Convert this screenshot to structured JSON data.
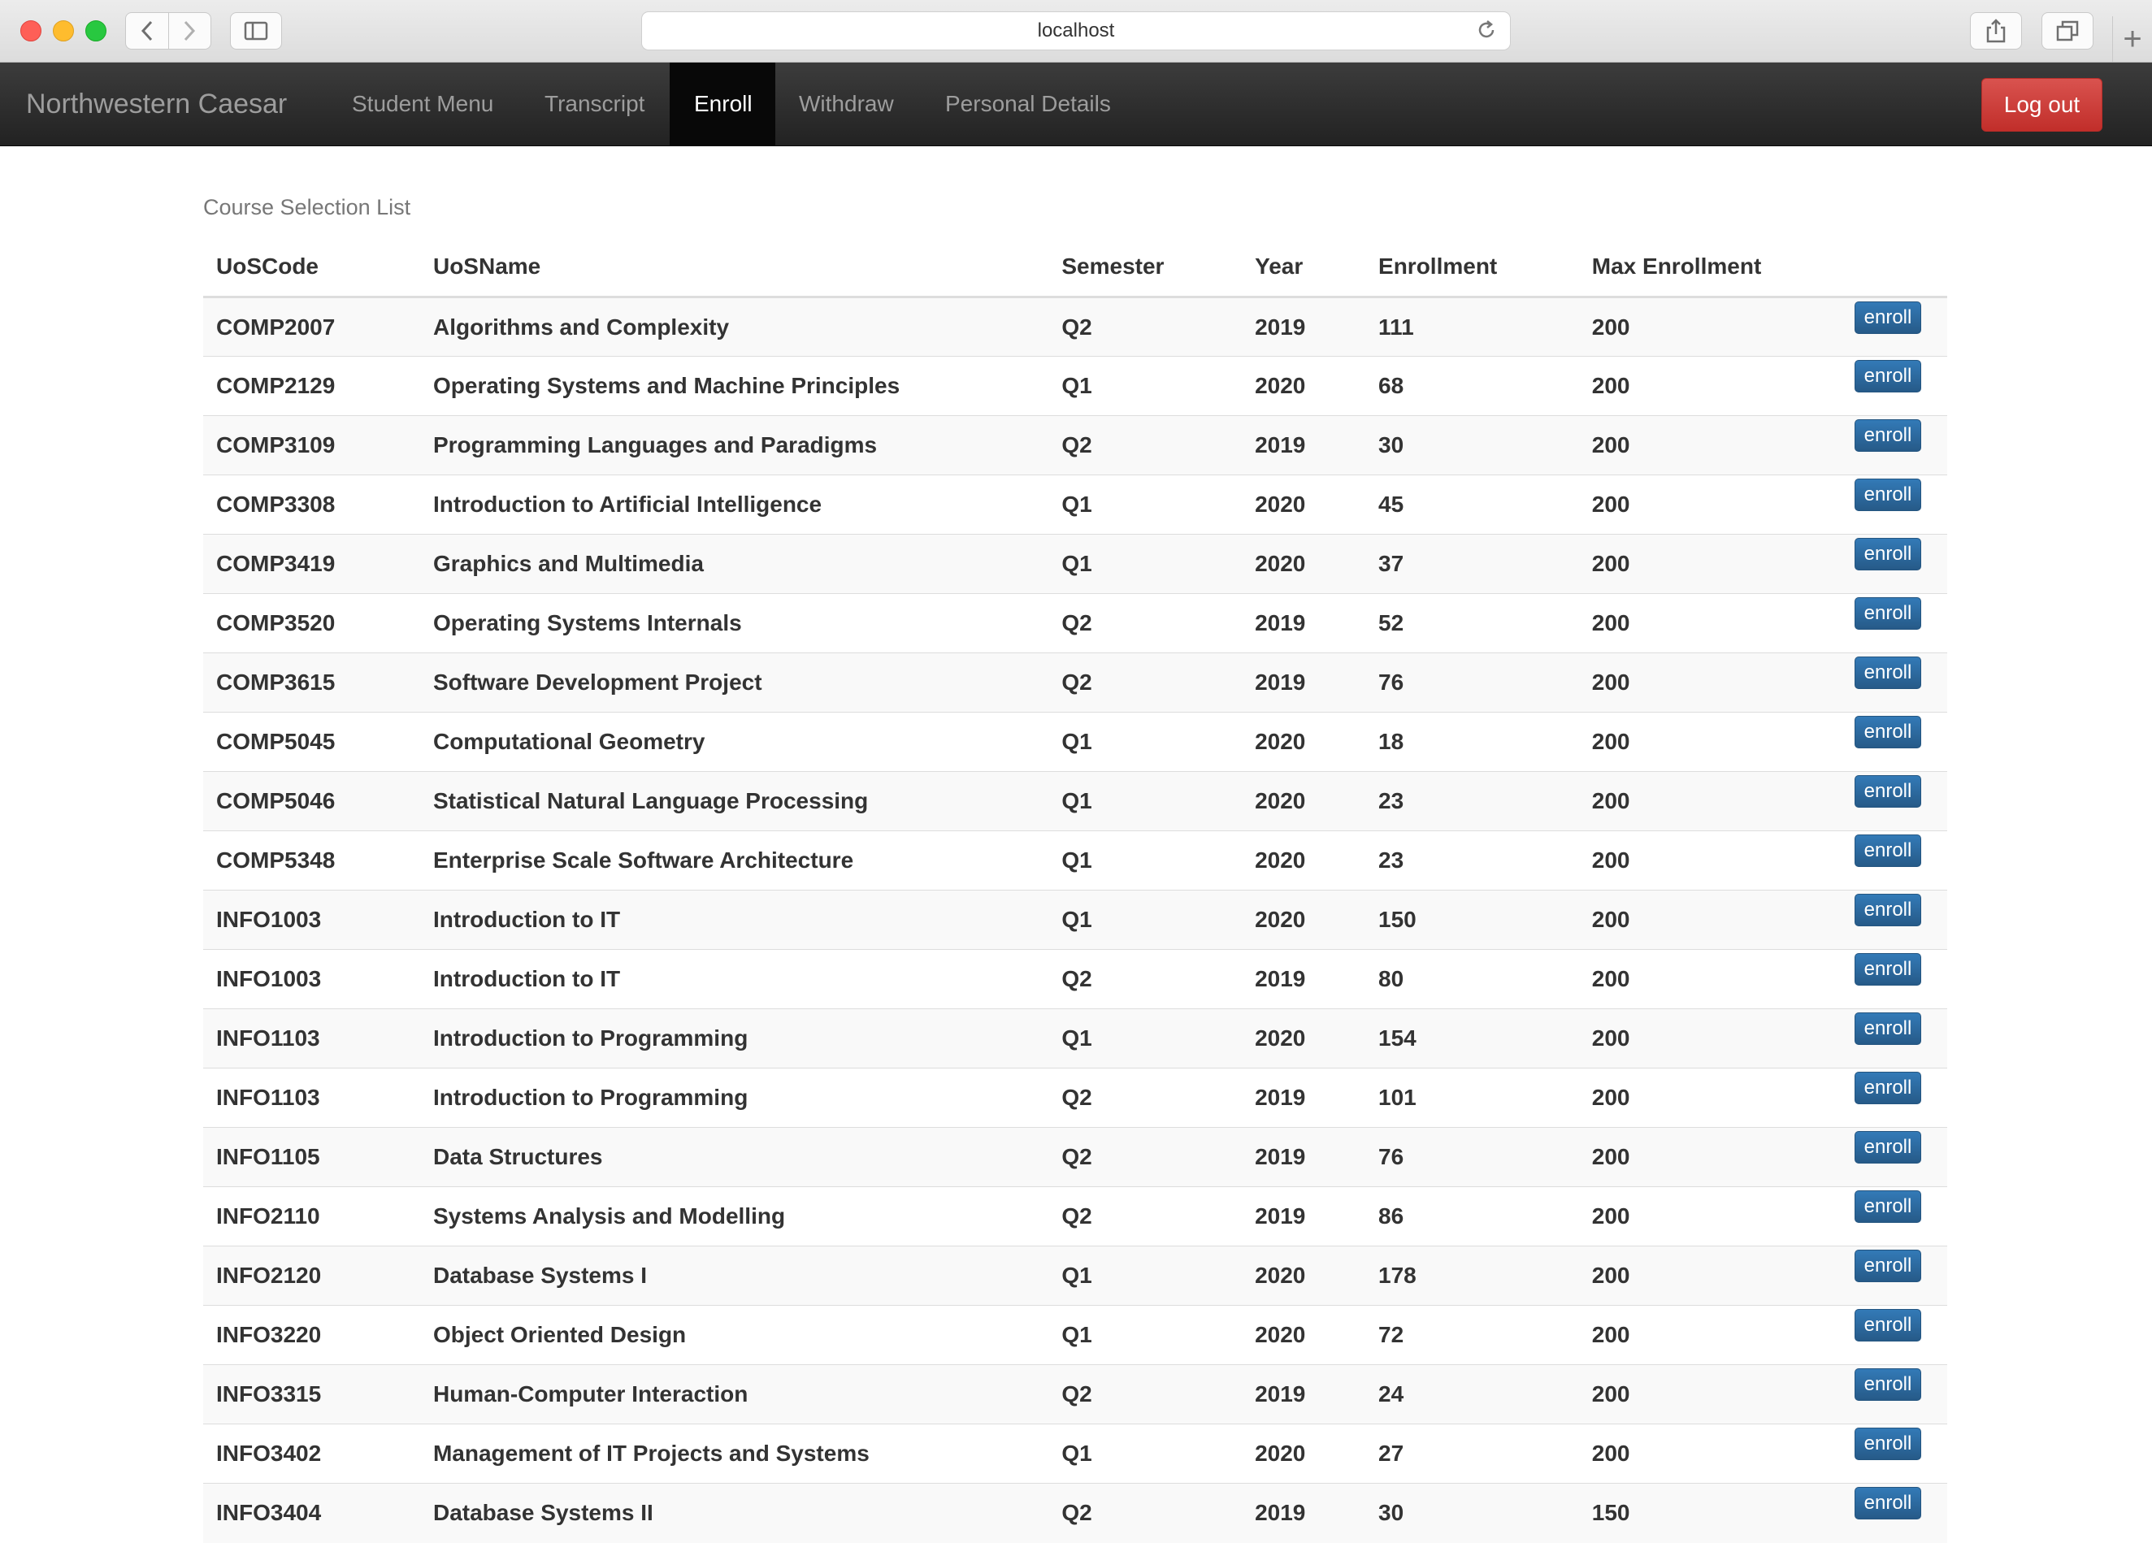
{
  "browser": {
    "url": "localhost"
  },
  "navbar": {
    "brand": "Northwestern Caesar",
    "items": [
      {
        "label": "Student Menu"
      },
      {
        "label": "Transcript"
      },
      {
        "label": "Enroll"
      },
      {
        "label": "Withdraw"
      },
      {
        "label": "Personal Details"
      }
    ],
    "active_item": "Enroll",
    "logout_label": "Log out"
  },
  "main": {
    "caption": "Course Selection List",
    "columns": [
      "UoSCode",
      "UoSName",
      "Semester",
      "Year",
      "Enrollment",
      "Max Enrollment"
    ],
    "action_label": "enroll",
    "rows": [
      {
        "code": "COMP2007",
        "name": "Algorithms and Complexity",
        "semester": "Q2",
        "year": "2019",
        "enrollment": "111",
        "max": "200"
      },
      {
        "code": "COMP2129",
        "name": "Operating Systems and Machine Principles",
        "semester": "Q1",
        "year": "2020",
        "enrollment": "68",
        "max": "200"
      },
      {
        "code": "COMP3109",
        "name": "Programming Languages and Paradigms",
        "semester": "Q2",
        "year": "2019",
        "enrollment": "30",
        "max": "200"
      },
      {
        "code": "COMP3308",
        "name": "Introduction to Artificial Intelligence",
        "semester": "Q1",
        "year": "2020",
        "enrollment": "45",
        "max": "200"
      },
      {
        "code": "COMP3419",
        "name": "Graphics and Multimedia",
        "semester": "Q1",
        "year": "2020",
        "enrollment": "37",
        "max": "200"
      },
      {
        "code": "COMP3520",
        "name": "Operating Systems Internals",
        "semester": "Q2",
        "year": "2019",
        "enrollment": "52",
        "max": "200"
      },
      {
        "code": "COMP3615",
        "name": "Software Development Project",
        "semester": "Q2",
        "year": "2019",
        "enrollment": "76",
        "max": "200"
      },
      {
        "code": "COMP5045",
        "name": "Computational Geometry",
        "semester": "Q1",
        "year": "2020",
        "enrollment": "18",
        "max": "200"
      },
      {
        "code": "COMP5046",
        "name": "Statistical Natural Language Processing",
        "semester": "Q1",
        "year": "2020",
        "enrollment": "23",
        "max": "200"
      },
      {
        "code": "COMP5348",
        "name": "Enterprise Scale Software Architecture",
        "semester": "Q1",
        "year": "2020",
        "enrollment": "23",
        "max": "200"
      },
      {
        "code": "INFO1003",
        "name": "Introduction to IT",
        "semester": "Q1",
        "year": "2020",
        "enrollment": "150",
        "max": "200"
      },
      {
        "code": "INFO1003",
        "name": "Introduction to IT",
        "semester": "Q2",
        "year": "2019",
        "enrollment": "80",
        "max": "200"
      },
      {
        "code": "INFO1103",
        "name": "Introduction to Programming",
        "semester": "Q1",
        "year": "2020",
        "enrollment": "154",
        "max": "200"
      },
      {
        "code": "INFO1103",
        "name": "Introduction to Programming",
        "semester": "Q2",
        "year": "2019",
        "enrollment": "101",
        "max": "200"
      },
      {
        "code": "INFO1105",
        "name": "Data Structures",
        "semester": "Q2",
        "year": "2019",
        "enrollment": "76",
        "max": "200"
      },
      {
        "code": "INFO2110",
        "name": "Systems Analysis and Modelling",
        "semester": "Q2",
        "year": "2019",
        "enrollment": "86",
        "max": "200"
      },
      {
        "code": "INFO2120",
        "name": "Database Systems I",
        "semester": "Q1",
        "year": "2020",
        "enrollment": "178",
        "max": "200"
      },
      {
        "code": "INFO3220",
        "name": "Object Oriented Design",
        "semester": "Q1",
        "year": "2020",
        "enrollment": "72",
        "max": "200"
      },
      {
        "code": "INFO3315",
        "name": "Human-Computer Interaction",
        "semester": "Q2",
        "year": "2019",
        "enrollment": "24",
        "max": "200"
      },
      {
        "code": "INFO3402",
        "name": "Management of IT Projects and Systems",
        "semester": "Q1",
        "year": "2020",
        "enrollment": "27",
        "max": "200"
      },
      {
        "code": "INFO3404",
        "name": "Database Systems II",
        "semester": "Q2",
        "year": "2019",
        "enrollment": "30",
        "max": "150"
      }
    ]
  },
  "colors": {
    "navbar_bg": "#222222",
    "active_nav_bg": "#080808",
    "logout_red": "#d9534f",
    "enroll_blue": "#337ab7"
  },
  "icons": [
    "back-icon",
    "forward-icon",
    "sidebar-icon",
    "reload-icon",
    "share-icon",
    "tabs-icon",
    "new-tab-icon"
  ]
}
